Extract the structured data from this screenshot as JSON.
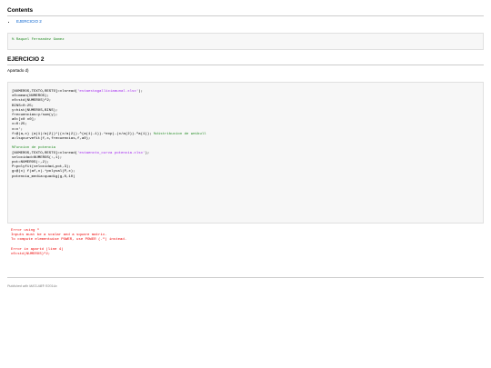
{
  "contents": {
    "title": "Contents",
    "items": [
      {
        "label": "EJERCICIO 2"
      }
    ]
  },
  "author_box": {
    "text": "% Raquel Fernandez Gomez"
  },
  "section": {
    "title": "EJERCICIO 2",
    "subtitle": "Apartado d)"
  },
  "code": {
    "lines": [
      [
        {
          "t": "[NUMEROS,TEXTO,RESTO]=xlsread("
        },
        {
          "t": "'estaestagalliciamunal.xlsx'",
          "c": "str"
        },
        {
          "t": ");"
        }
      ],
      [
        {
          "t": "x0=mean(NUMEROS);"
        }
      ],
      [
        {
          "t": "c0=std(NUMEROS)^2;"
        }
      ],
      [
        {
          "t": "BINS=0:25;"
        }
      ],
      [
        {
          "t": "y=hist(NUMEROS,BINS);"
        }
      ],
      [
        {
          "t": "frecuencias=y/sum(y);"
        }
      ],
      [
        {
          "t": "a0=[c0 x0];"
        }
      ],
      [
        {
          "t": "x=0:25;"
        }
      ],
      [
        {
          "t": "x=x';"
        }
      ],
      [
        {
          "t": "f=@(a,x) (a(1)/a(2))*((x/a(2)).^(a(1)-1)).*exp(-(x/a(2)).^a(1)); "
        },
        {
          "t": "%distribucion de weibull",
          "c": "cmt"
        }
      ],
      [
        {
          "t": "a=lsqcurvefit(f,x,frecuencias,f,a0);"
        }
      ],
      [
        {
          "t": ""
        }
      ],
      [
        {
          "t": "%Funcion de potencia",
          "c": "cmt"
        }
      ],
      [
        {
          "t": "[NUMEROS,TEXTO,RESTO]=xlsread("
        },
        {
          "t": "'estaencto_curva potencia.xlsx'",
          "c": "str"
        },
        {
          "t": ");"
        }
      ],
      [
        {
          "t": "velocidad=NUMEROS(:,1);"
        }
      ],
      [
        {
          "t": "pot=NUMEROS(:,2);"
        }
      ],
      [
        {
          "t": "P=polyfit(velocidad,pot,3);"
        }
      ],
      [
        {
          "t": "g=@(x) f(af,x).*polyval(P,x);"
        }
      ],
      [
        {
          "t": "potencia_media=quadig(g,0,10)"
        }
      ]
    ]
  },
  "error": {
    "lines": [
      "Error using ^",
      "Inputs must be a scalar and a square matrix.",
      "To compute elementwise POWER, use POWER (.^) instead.",
      "",
      "Error in apartd (line 4)",
      "c0=std(NUMEROS)^2;"
    ]
  },
  "footer": {
    "text": "Published with MATLAB® R2014a"
  }
}
